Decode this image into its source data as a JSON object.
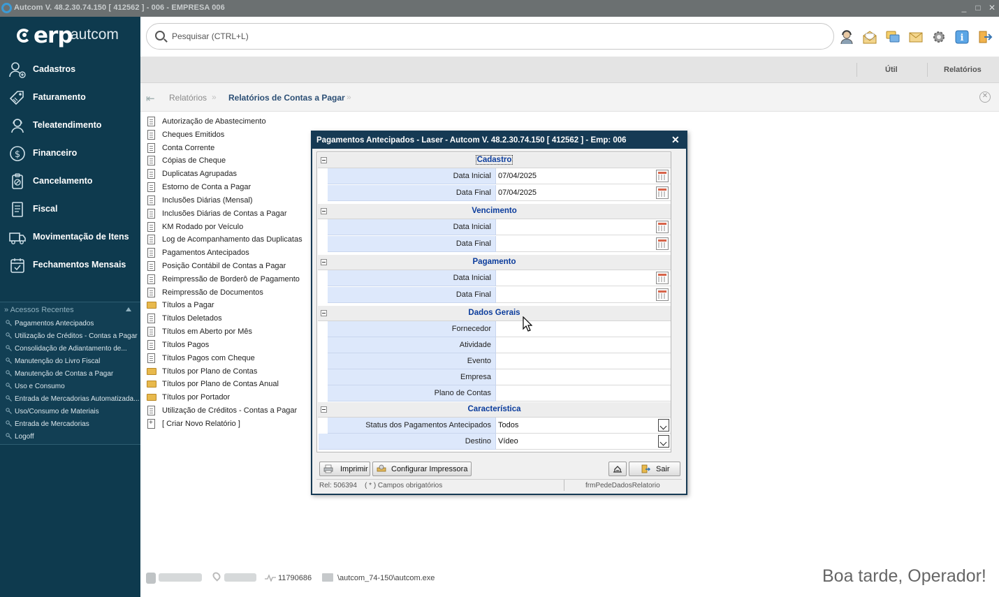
{
  "window": {
    "title": "Autcom V. 48.2.30.74.150 [ 412562 ] - 006 - EMPRESA 006",
    "controls": [
      "_",
      "□",
      "✕"
    ]
  },
  "brand": {
    "erp": "erp",
    "autcom": "autcom"
  },
  "sidebar": {
    "items": [
      {
        "label": "Cadastros",
        "icon": "user-add-icon"
      },
      {
        "label": "Faturamento",
        "icon": "tag-icon"
      },
      {
        "label": "Teleatendimento",
        "icon": "headset-icon"
      },
      {
        "label": "Financeiro",
        "icon": "dollar-icon"
      },
      {
        "label": "Cancelamento",
        "icon": "clipboard-cancel-icon"
      },
      {
        "label": "Fiscal",
        "icon": "document-icon"
      },
      {
        "label": "Movimentação de Itens",
        "icon": "truck-icon"
      },
      {
        "label": "Fechamentos Mensais",
        "icon": "calendar-check-icon"
      }
    ],
    "recent": {
      "title": "» Acessos Recentes",
      "items": [
        "Pagamentos Antecipados",
        "Utilização de Créditos - Contas a Pagar",
        "Consolidação de Adiantamento de...",
        "Manutenção do Livro Fiscal",
        "Manutenção de Contas a Pagar",
        "Uso e Consumo",
        "Entrada de Mercadorias Automatizada...",
        "Uso/Consumo de Materiais",
        "Entrada de Mercadorias",
        "Logoff"
      ]
    }
  },
  "search": {
    "placeholder": "Pesquisar (CTRL+L)"
  },
  "top_icons": [
    "support-agent-icon",
    "mail-open-icon",
    "chat-icon",
    "envelope-icon",
    "settings-gear-icon",
    "info-icon",
    "exit-icon"
  ],
  "toolbar": {
    "util": "Útil",
    "relatorios": "Relatórios"
  },
  "breadcrumb": {
    "root": "Relatórios",
    "current": "Relatórios de Contas a Pagar"
  },
  "reports": [
    {
      "label": "Autorização de Abastecimento",
      "kind": "report"
    },
    {
      "label": "Cheques Emitidos",
      "kind": "report"
    },
    {
      "label": "Conta Corrente",
      "kind": "report"
    },
    {
      "label": "Cópias de Cheque",
      "kind": "report"
    },
    {
      "label": "Duplicatas Agrupadas",
      "kind": "report"
    },
    {
      "label": "Estorno de Conta a Pagar",
      "kind": "report"
    },
    {
      "label": "Inclusões Diárias (Mensal)",
      "kind": "report"
    },
    {
      "label": "Inclusões Diárias de Contas a Pagar",
      "kind": "report"
    },
    {
      "label": "KM Rodado por Veículo",
      "kind": "report"
    },
    {
      "label": "Log de Acompanhamento das Duplicatas",
      "kind": "report"
    },
    {
      "label": "Pagamentos Antecipados",
      "kind": "report"
    },
    {
      "label": "Posição Contábil de Contas a Pagar",
      "kind": "report"
    },
    {
      "label": "Reimpressão de Borderô de Pagamento",
      "kind": "report"
    },
    {
      "label": "Reimpressão de Documentos",
      "kind": "report"
    },
    {
      "label": "Títulos a Pagar",
      "kind": "folder"
    },
    {
      "label": "Títulos Deletados",
      "kind": "report"
    },
    {
      "label": "Títulos em Aberto por Mês",
      "kind": "report"
    },
    {
      "label": "Títulos Pagos",
      "kind": "report"
    },
    {
      "label": "Títulos Pagos com Cheque",
      "kind": "report"
    },
    {
      "label": "Títulos por Plano de Contas",
      "kind": "folder"
    },
    {
      "label": "Títulos por Plano de Contas Anual",
      "kind": "folder"
    },
    {
      "label": "Títulos por Portador",
      "kind": "folder"
    },
    {
      "label": "Utilização de Créditos - Contas a Pagar",
      "kind": "report"
    },
    {
      "label": "[ Criar Novo Relatório ]",
      "kind": "new"
    }
  ],
  "footer": {
    "number": "11790686",
    "path": "\\autcom_74-150\\autcom.exe",
    "greeting": "Boa tarde, Operador!"
  },
  "dialog": {
    "title": "Pagamentos Antecipados - Laser   -   Autcom V. 48.2.30.74.150 [ 412562 ] - Emp: 006",
    "sections": {
      "cadastro": "Cadastro",
      "vencimento": "Vencimento",
      "pagamento": "Pagamento",
      "dados_gerais": "Dados Gerais",
      "caracteristica": "Característica"
    },
    "fields": {
      "cad_ini": {
        "label": "Data Inicial",
        "value": "07/04/2025"
      },
      "cad_fim": {
        "label": "Data Final",
        "value": "07/04/2025"
      },
      "ven_ini": {
        "label": "Data Inicial",
        "value": ""
      },
      "ven_fim": {
        "label": "Data Final",
        "value": ""
      },
      "pag_ini": {
        "label": "Data Inicial",
        "value": ""
      },
      "pag_fim": {
        "label": "Data Final",
        "value": ""
      },
      "fornecedor": {
        "label": "Fornecedor",
        "value": ""
      },
      "atividade": {
        "label": "Atividade",
        "value": ""
      },
      "evento": {
        "label": "Evento",
        "value": ""
      },
      "empresa": {
        "label": "Empresa",
        "value": ""
      },
      "plano": {
        "label": "Plano de Contas",
        "value": ""
      },
      "status": {
        "label": "Status dos Pagamentos Antecipados",
        "value": "Todos"
      },
      "destino": {
        "label": "Destino",
        "value": "Vídeo"
      }
    },
    "buttons": {
      "imprimir": "Imprimir",
      "configurar": "Configurar Impressora",
      "sair": "Sair"
    },
    "status": {
      "left": "Rel: 506394    ( * ) Campos obrigatórios",
      "right": "frmPedeDadosRelatorio"
    }
  },
  "colors": {
    "sidebar": "#0e3a4e",
    "dialog_title": "#163a54",
    "section_title": "#0b3c9c",
    "label_bg": "#dde8fb"
  }
}
